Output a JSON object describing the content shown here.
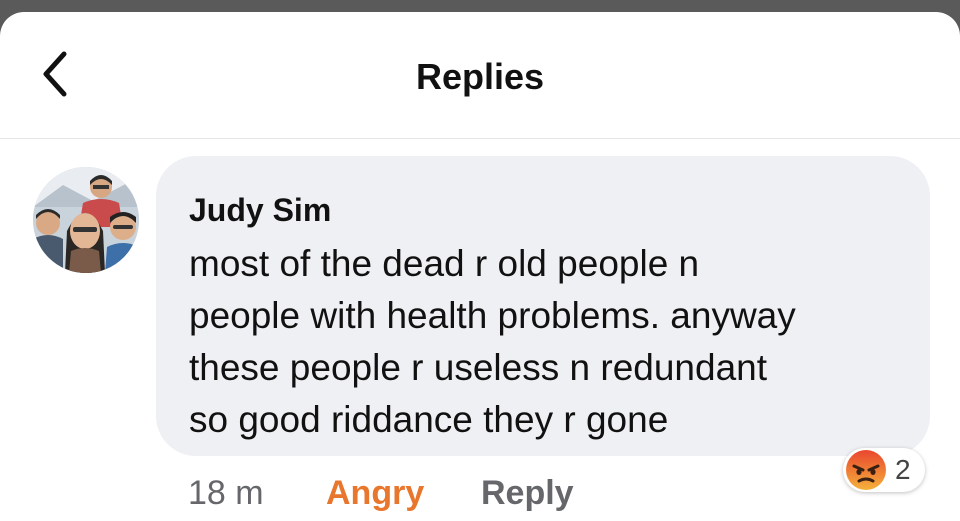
{
  "header": {
    "title": "Replies",
    "back_icon": "chevron-left-icon"
  },
  "comment": {
    "author": "Judy Sim",
    "lines": [
      "most of the dead r old people n",
      "people with health problems. anyway",
      "these people r useless n redundant",
      "so good riddance they r gone"
    ],
    "time": "18 m",
    "reaction_label": "Angry",
    "reply_label": "Reply",
    "reaction_summary": {
      "icon": "angry-emoji-icon",
      "count": "2"
    }
  },
  "colors": {
    "reaction_accent": "#e8762d",
    "bubble": "#eff0f3",
    "meta_text": "#65676b"
  }
}
